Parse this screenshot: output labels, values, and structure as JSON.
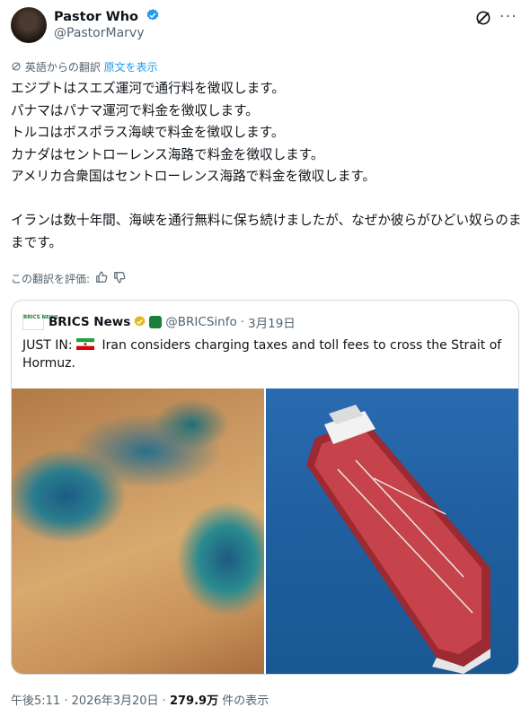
{
  "author": {
    "name": "Pastor Who",
    "handle": "@PastorMarvy"
  },
  "translation": {
    "label": "英語からの翻訳",
    "show_original": "原文を表示"
  },
  "post_text": "エジプトはスエズ運河で通行料を徴収します。\nパナマはパナマ運河で料金を徴収します。\nトルコはボスポラス海峡で料金を徴収します。\nカナダはセントローレンス海路で料金を徴収します。\nアメリカ合衆国はセントローレンス海路で料金を徴収します。\n\nイランは数十年間、海峡を通行無料に保ち続けましたが、なぜか彼らがひどい奴らのままです。",
  "rate_translation": "この翻訳を評価:",
  "quote": {
    "logo_text": "BRICS NEWS",
    "name": "BRICS News",
    "handle": "@BRICSinfo",
    "separator": "·",
    "date": "3月19日",
    "text_prefix": "JUST IN:",
    "text_body": "Iran considers charging taxes and toll fees to cross the Strait of Hormuz."
  },
  "footer": {
    "time": "午後5:11",
    "separator": "·",
    "date": "2026年3月20日",
    "views": "279.9万",
    "views_label": "件の表示"
  },
  "colors": {
    "accent": "#1d9bf0",
    "verified_gold": "#e2b719",
    "muted": "#536471"
  }
}
